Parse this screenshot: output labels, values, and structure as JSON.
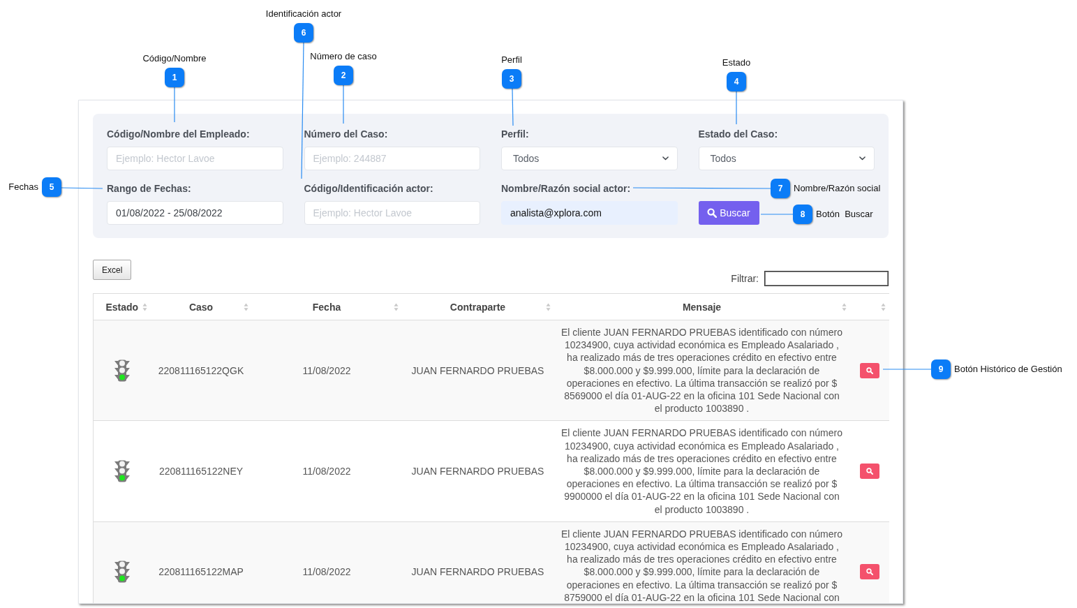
{
  "filters": {
    "fields": [
      {
        "kind": "text",
        "label": "Código/Nombre del Empleado:",
        "placeholder": "Ejemplo: Hector Lavoe",
        "autofilled": false
      },
      {
        "kind": "text",
        "label": "Número del Caso:",
        "placeholder": "Ejemplo: 244887",
        "autofilled": false
      },
      {
        "kind": "select",
        "label": "Perfil:",
        "value": "Todos"
      },
      {
        "kind": "select",
        "label": "Estado del Caso:",
        "value": "Todos"
      },
      {
        "kind": "text",
        "label": "Rango de Fechas:",
        "value": "01/08/2022 - 25/08/2022",
        "autofilled": false
      },
      {
        "kind": "text",
        "label": "Código/Identificación actor:",
        "placeholder": "Ejemplo: Hector Lavoe",
        "autofilled": false
      },
      {
        "kind": "text",
        "label": "Nombre/Razón social actor:",
        "value": "analista@xplora.com",
        "autofilled": true
      },
      {
        "kind": "button",
        "label": "Buscar"
      }
    ]
  },
  "toolbar": {
    "excel_button": "Excel",
    "filter_label": "Filtrar:"
  },
  "table": {
    "columns": [
      {
        "label": "Estado",
        "sortable": true
      },
      {
        "label": "Caso",
        "sortable": true
      },
      {
        "label": "Fecha",
        "sortable": true
      },
      {
        "label": "Contraparte",
        "sortable": true
      },
      {
        "label": "Mensaje",
        "sortable": true
      },
      {
        "sortable": true
      }
    ],
    "rows": [
      {
        "color": "#1ee61e",
        "case": "220811165122QGK",
        "date": "11/08/2022",
        "counterpart": "JUAN FERNARDO PRUEBAS",
        "message": "El cliente JUAN FERNARDO PRUEBAS identificado con número 10234900, cuya actividad económica es Empleado Asalariado , ha realizado más de tres operaciones crédito en efectivo entre $8.000.000 y $9.999.000, límite para la declaración de operaciones en efectivo. La última transacción se realizó por $ 8569000 el día 01-AUG-22 en la oficina 101 Sede Nacional con el producto 1003890 ."
      },
      {
        "color": "#1ee61e",
        "case": "220811165122NEY",
        "date": "11/08/2022",
        "counterpart": "JUAN FERNARDO PRUEBAS",
        "message": "El cliente JUAN FERNARDO PRUEBAS identificado con número 10234900, cuya actividad económica es Empleado Asalariado , ha realizado más de tres operaciones crédito en efectivo entre $8.000.000 y $9.999.000, límite para la declaración de operaciones en efectivo. La última transacción se realizó por $ 9900000 el día 01-AUG-22 en la oficina 101 Sede Nacional con el producto 1003890 ."
      },
      {
        "color": "#1ee61e",
        "case": "220811165122MAP",
        "date": "11/08/2022",
        "counterpart": "JUAN FERNARDO PRUEBAS",
        "message": "El cliente JUAN FERNARDO PRUEBAS identificado con número 10234900, cuya actividad económica es Empleado Asalariado , ha realizado más de tres operaciones crédito en efectivo entre $8.000.000 y $9.999.000, límite para la declaración de operaciones en efectivo. La última transacción se realizó por $ 8759000 el día 01-AUG-22 en la oficina 101 Sede Nacional con"
      }
    ]
  },
  "callouts": [
    {
      "number": "1",
      "label": "Código/Nombre"
    },
    {
      "number": "2",
      "label": "Número de caso"
    },
    {
      "number": "3",
      "label": "Perfil"
    },
    {
      "number": "4",
      "label": "Estado"
    },
    {
      "number": "5",
      "label": "Fechas"
    },
    {
      "number": "6",
      "label": "Identificación actor"
    },
    {
      "number": "7",
      "label": "Nombre/Razón social"
    },
    {
      "number": "8",
      "label": "Botón  Buscar"
    },
    {
      "number": "9",
      "label": "Botón Histórico de Gestión"
    }
  ]
}
